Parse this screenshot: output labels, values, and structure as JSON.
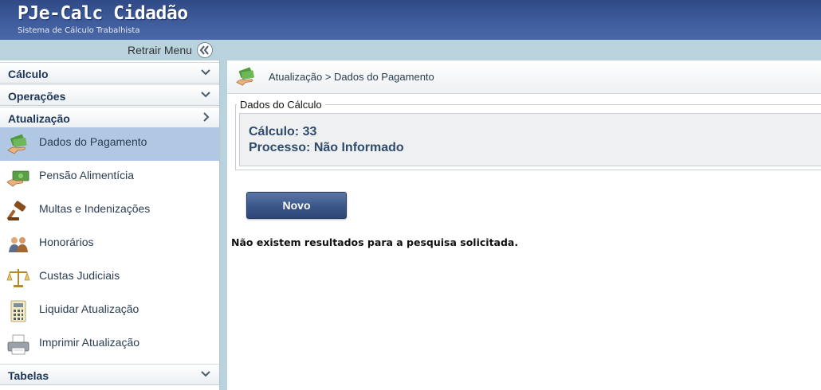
{
  "header": {
    "title": "PJe-Calc Cidadão",
    "subtitle": "Sistema de Cálculo Trabalhista"
  },
  "retrair": {
    "label": "Retrair Menu",
    "icon": "double-chevron-left-icon"
  },
  "sidebar": {
    "sections": [
      {
        "label": "Cálculo",
        "icon": "chevron-down-icon"
      },
      {
        "label": "Operações",
        "icon": "chevron-down-icon"
      },
      {
        "label": "Atualização",
        "icon": "chevron-right-icon"
      },
      {
        "label": "Tabelas",
        "icon": "chevron-down-icon"
      }
    ],
    "items": [
      {
        "label": "Dados do Pagamento",
        "icon": "money-hand-icon",
        "selected": true
      },
      {
        "label": "Pensão Alimentícia",
        "icon": "money-card-icon"
      },
      {
        "label": "Multas e Indenizações",
        "icon": "gavel-icon"
      },
      {
        "label": "Honorários",
        "icon": "people-icon"
      },
      {
        "label": "Custas Judiciais",
        "icon": "scales-icon"
      },
      {
        "label": "Liquidar Atualização",
        "icon": "calculator-icon"
      },
      {
        "label": "Imprimir Atualização",
        "icon": "printer-icon"
      }
    ]
  },
  "breadcrumb": {
    "text": "Atualização > Dados do Pagamento",
    "icon": "money-hand-icon"
  },
  "dados_calculo": {
    "legend": "Dados do Cálculo",
    "calculo_line": "Cálculo: 33",
    "processo_line": "Processo: Não Informado"
  },
  "actions": {
    "novo_label": "Novo"
  },
  "messages": {
    "no_results": "Não existem resultados para a pesquisa solicitada."
  },
  "colors": {
    "header": "#3d5a9a",
    "bar": "#b8d3dd",
    "selected": "#b0c8e4",
    "button": "#3a558a"
  }
}
